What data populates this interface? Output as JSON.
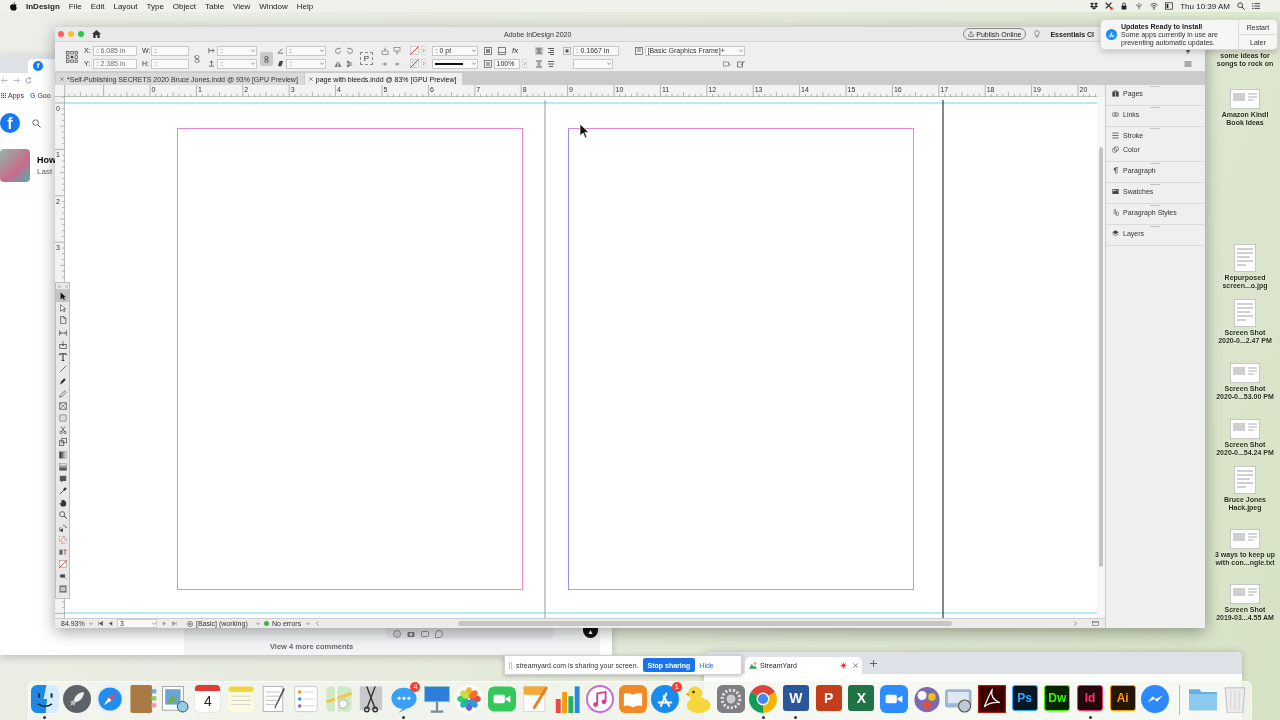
{
  "menu_bar": {
    "app_name": "InDesign",
    "menus": [
      "File",
      "Edit",
      "Layout",
      "Type",
      "Object",
      "Table",
      "View",
      "Window",
      "Help"
    ],
    "clock": "Thu 10:39 AM"
  },
  "desktop_icons": [
    {
      "label_lines": [
        "some ideas for",
        "songs to rock on"
      ]
    },
    {
      "label_lines": [
        "Amazon Kindl",
        "Book Ideas"
      ]
    },
    {
      "label_lines": [
        "Repurposed",
        "screen...o.jpg"
      ]
    },
    {
      "label_lines": [
        "Screen Shot",
        "2020-0...2.47 PM"
      ]
    },
    {
      "label_lines": [
        "Screen Shot",
        "2020-0...53.00 PM"
      ]
    },
    {
      "label_lines": [
        "Screen Shot",
        "2020-0...54.24 PM"
      ]
    },
    {
      "label_lines": [
        "Bruce Jones",
        "Hack.jpeg"
      ]
    },
    {
      "label_lines": [
        "3 ways to keep up",
        "with con...ngle.txt"
      ]
    },
    {
      "label_lines": [
        "Screen Shot",
        "2019-03...4.55 AM"
      ]
    }
  ],
  "browser_back": {
    "favicon_letter": "f",
    "bookmarks": [
      {
        "kind": "apps",
        "label": "Apps"
      },
      {
        "kind": "site",
        "letter": "G",
        "label": "Goo"
      }
    ],
    "logo_letter": "f",
    "post_title": "How",
    "post_meta": "Last",
    "comments_link": "View 4 more comments"
  },
  "indesign": {
    "title": "Adobe InDesign 2020",
    "publish_button": "Publish Online",
    "workspace": "Essentials Cl",
    "control_panel": {
      "x_label": "X:",
      "x_value": "6.085 in",
      "y_label": "Y:",
      "y_value": "2.385 in",
      "w_label": "W:",
      "h_label": "H:",
      "frame_glyph": "P",
      "effects_glyph": "fx",
      "stroke_weight": "0 pt",
      "scale_percent": "100%",
      "inset": "0.1667 in",
      "object_style": "[Basic Graphics Frame]+"
    },
    "doc_tabs": [
      {
        "label": "*Self-Publishing SECRETS 2020 Bruce Jones.indd @ 93% [GPU Preview]",
        "selected": false
      },
      {
        "label": "page with bleeds.indd @ 83% [GPU Preview]",
        "selected": true
      }
    ],
    "rulers": {
      "horizontal": [
        "0",
        "1",
        "2",
        "3",
        "4",
        "5",
        "6",
        "7",
        "8",
        "9",
        "10",
        "11",
        "12",
        "13",
        "14",
        "15",
        "16",
        "17",
        "18",
        "19",
        "20"
      ],
      "vertical": [
        "0",
        "1",
        "2",
        "3"
      ]
    },
    "tools": [
      {
        "selected": true
      },
      {
        "selected": false
      },
      {
        "selected": false
      },
      {
        "selected": false
      },
      {
        "selected": false
      },
      {
        "selected": false
      },
      {
        "selected": false
      },
      {
        "selected": false
      },
      {
        "selected": false
      },
      {
        "selected": false
      },
      {
        "selected": false
      },
      {
        "selected": false
      },
      {
        "selected": false
      },
      {
        "selected": false
      },
      {
        "selected": false
      },
      {
        "selected": false
      },
      {
        "selected": false
      },
      {
        "selected": false
      },
      {
        "selected": false
      },
      {
        "selected": false
      },
      {
        "selected": false
      },
      {
        "selected": false
      },
      {
        "selected": false
      },
      {
        "selected": false
      },
      {
        "selected": false
      }
    ],
    "panels": [
      [
        "Pages"
      ],
      [
        "Links"
      ],
      [
        "Stroke",
        "Color"
      ],
      [
        "Paragraph"
      ],
      [
        "Swatches"
      ],
      [
        "Paragraph Styles"
      ],
      [
        "Layers"
      ]
    ],
    "status_bar": {
      "zoom": "84.93%",
      "page": "3",
      "preflight_profile": "[Basic] (working)",
      "preflight_ok": true,
      "preflight_status": "No errors"
    }
  },
  "notification": {
    "title": "Updates Ready to Install",
    "body": "Some apps currently in use are preventing automatic updates.",
    "actions": [
      "Restart",
      "Later"
    ]
  },
  "streamyard_tab": {
    "title": "StreamYard",
    "recording": true
  },
  "sharing_bar": {
    "message": "streamyard.com is sharing your screen.",
    "stop_button": "Stop sharing",
    "hide_link": "Hide"
  },
  "dock": {
    "apps": [
      {
        "kind": "face",
        "running": true
      },
      {
        "kind": "rocket",
        "running": false
      },
      {
        "kind": "compass",
        "running": false
      },
      {
        "kind": "notebook",
        "running": false
      },
      {
        "kind": "photo",
        "running": false
      },
      {
        "kind": "calendar",
        "text": "4",
        "running": false
      },
      {
        "kind": "notepad",
        "running": false
      },
      {
        "kind": "document",
        "running": false
      },
      {
        "kind": "checklist",
        "running": false
      },
      {
        "kind": "map",
        "running": false
      },
      {
        "kind": "scissors",
        "running": false
      },
      {
        "kind": "speech",
        "badge": "4",
        "running": true
      },
      {
        "kind": "podium",
        "running": false
      },
      {
        "kind": "flower",
        "running": false
      },
      {
        "kind": "camera",
        "running": false
      },
      {
        "kind": "pen",
        "running": false
      },
      {
        "kind": "chart",
        "running": false
      },
      {
        "kind": "music",
        "running": false
      },
      {
        "kind": "book",
        "running": false
      },
      {
        "kind": "store",
        "badge": "1",
        "running": false
      },
      {
        "kind": "duck",
        "running": false
      },
      {
        "kind": "gear",
        "running": false
      },
      {
        "kind": "ring",
        "running": true
      },
      {
        "kind": "office",
        "text": "W",
        "color": "#2b579a",
        "running": true
      },
      {
        "kind": "office",
        "text": "P",
        "color": "#c43e1c",
        "running": false
      },
      {
        "kind": "office",
        "text": "X",
        "color": "#217346",
        "running": false
      },
      {
        "kind": "video",
        "running": false
      },
      {
        "kind": "bubbles",
        "running": false
      },
      {
        "kind": "scanner",
        "running": false
      },
      {
        "kind": "swoosh",
        "running": false
      },
      {
        "kind": "adobe",
        "text": "Ps",
        "color": "#31a8ff",
        "running": false
      },
      {
        "kind": "adobe",
        "text": "Dw",
        "color": "#35fa00",
        "running": false
      },
      {
        "kind": "adobe",
        "text": "Id",
        "color": "#ff3366",
        "running": true
      },
      {
        "kind": "adobe",
        "text": "Ai",
        "color": "#ff9a00",
        "running": false
      },
      {
        "kind": "bolt",
        "running": false
      }
    ],
    "stacks": [
      {
        "kind": "folder"
      },
      {
        "kind": "trash"
      }
    ]
  }
}
